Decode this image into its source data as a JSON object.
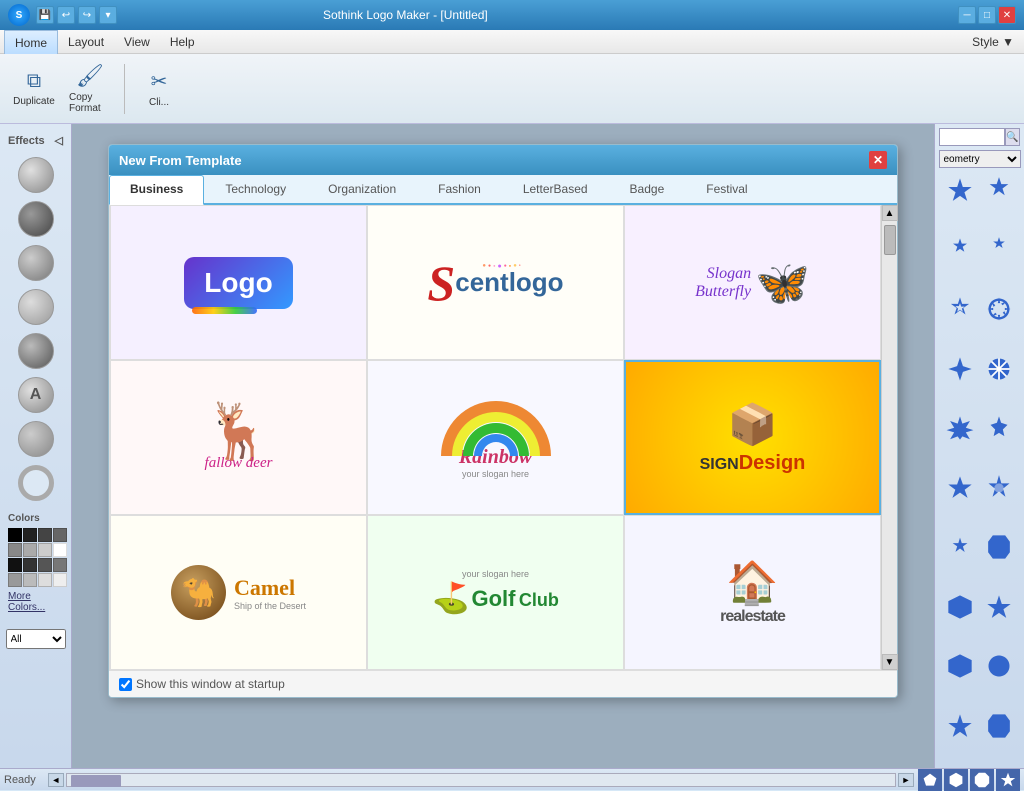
{
  "window": {
    "title": "Sothink Logo Maker - [Untitled]",
    "style_label": "Style ▼"
  },
  "menu": {
    "items": [
      "Home",
      "Layout",
      "View",
      "Help"
    ]
  },
  "toolbar": {
    "buttons": [
      {
        "label": "Duplicate",
        "icon": "⧉"
      },
      {
        "label": "Copy Format",
        "icon": "🖌"
      },
      {
        "label": "Cli...",
        "icon": "✂"
      }
    ]
  },
  "dialog": {
    "title": "New From Template",
    "tabs": [
      "Business",
      "Technology",
      "Organization",
      "Fashion",
      "LetterBased",
      "Badge",
      "Festival"
    ],
    "active_tab": "Business",
    "footer_checkbox": "Show this window at startup",
    "templates": [
      {
        "id": "logo1",
        "name": "Logo colorful"
      },
      {
        "id": "logo2",
        "name": "Scentlogo"
      },
      {
        "id": "logo3",
        "name": "Slogan Butterfly"
      },
      {
        "id": "logo4",
        "name": "fallow deer"
      },
      {
        "id": "logo5",
        "name": "Rainbow"
      },
      {
        "id": "logo6",
        "name": "SignDesign"
      },
      {
        "id": "logo7",
        "name": "Camel"
      },
      {
        "id": "logo8",
        "name": "Golf Club"
      },
      {
        "id": "logo9",
        "name": "realestate"
      }
    ]
  },
  "effects": {
    "label": "Effects"
  },
  "colors": {
    "label": "Colors",
    "more_label": "More Colors...",
    "cells": [
      "#000",
      "#222",
      "#444",
      "#666",
      "#888",
      "#aaa",
      "#ccc",
      "#fff",
      "#111",
      "#333",
      "#555",
      "#777",
      "#999",
      "#bbb",
      "#ddd",
      "#eee"
    ]
  },
  "all_select": {
    "label": "All",
    "options": [
      "All"
    ]
  },
  "right_panel": {
    "geometry_label": "eometry",
    "search_placeholder": ""
  },
  "status": {
    "ready": "Ready"
  },
  "shapes": [
    "★",
    "✦",
    "✴",
    "✳",
    "✱",
    "✲",
    "❋",
    "❊",
    "❉",
    "❈",
    "✿",
    "❀",
    "⬡",
    "⬢",
    "★",
    "⬟",
    "⬠",
    "◆",
    "✶",
    "✷"
  ]
}
